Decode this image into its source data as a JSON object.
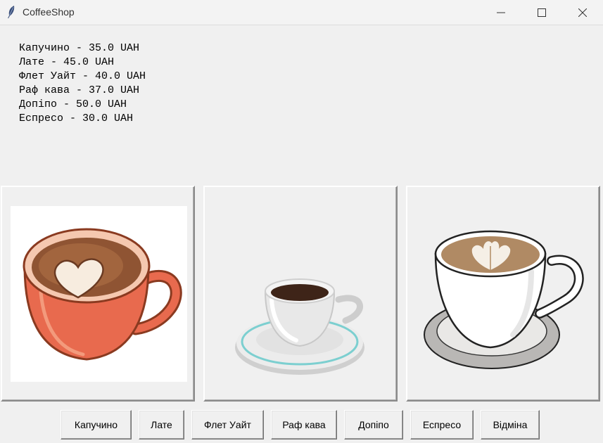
{
  "window": {
    "title": "CoffeeShop"
  },
  "menu": [
    "Капучино - 35.0 UAH",
    "Лате - 45.0 UAH",
    "Флет Уайт - 40.0 UAH",
    "Раф кава - 37.0 UAH",
    "Допіпо - 50.0 UAH",
    "Еспресо - 30.0 UAH"
  ],
  "buttons": {
    "cappuccino": "Капучино",
    "latte": "Лате",
    "flat_white": "Флет Уайт",
    "raf": "Раф кава",
    "doppio": "Допіпо",
    "espresso": "Еспресо",
    "cancel": "Відміна"
  }
}
